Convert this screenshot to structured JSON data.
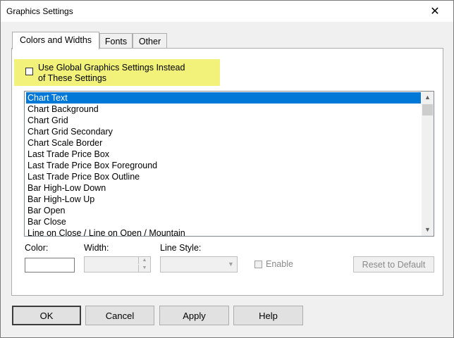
{
  "window": {
    "title": "Graphics Settings",
    "close_glyph": "✕"
  },
  "tabs": [
    {
      "label": "Colors and Widths",
      "active": true
    },
    {
      "label": "Fonts",
      "active": false
    },
    {
      "label": "Other",
      "active": false
    }
  ],
  "global": {
    "checked": false,
    "label_line1": "Use Global Graphics Settings Instead",
    "label_line2": "of These Settings",
    "highlight_color": "#f2f27a"
  },
  "list": {
    "selected_index": 0,
    "items": [
      "Chart Text",
      "Chart Background",
      "Chart Grid",
      "Chart Grid Secondary",
      "Chart Scale Border",
      "Last Trade Price Box",
      "Last Trade Price Box Foreground",
      "Last Trade Price Box Outline",
      "Bar High-Low Down",
      "Bar High-Low Up",
      "Bar Open",
      "Bar Close",
      "Line on Close / Line on Open / Mountain"
    ],
    "up_glyph": "▲",
    "down_glyph": "▼"
  },
  "controls": {
    "color_label": "Color:",
    "width_label": "Width:",
    "line_style_label": "Line Style:",
    "enable_label": "Enable",
    "enable_checked": false,
    "reset_label": "Reset to Default",
    "color_value": "#ffffff",
    "spin_up": "▲",
    "spin_down": "▼",
    "dropdown_glyph": "▼"
  },
  "buttons": {
    "ok": "OK",
    "cancel": "Cancel",
    "apply": "Apply",
    "help": "Help"
  },
  "colors": {
    "selection": "#0078d7",
    "window_bg": "#f0f0f0"
  }
}
